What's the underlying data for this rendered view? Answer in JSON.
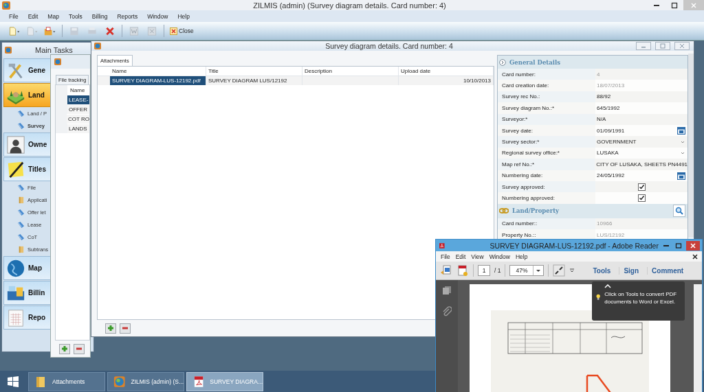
{
  "app": {
    "title": "ZILMIS (admin) (Survey diagram details. Card number: 4)"
  },
  "menu": [
    "File",
    "Edit",
    "Map",
    "Tools",
    "Billing",
    "Reports",
    "Window",
    "Help"
  ],
  "toolbar": {
    "close_label": "Close"
  },
  "main_tasks": {
    "title": "Main Tasks",
    "groups": [
      {
        "label": "Gene",
        "kind": "tools",
        "selected": false
      },
      {
        "label": "Land",
        "kind": "land",
        "selected": true,
        "items": [
          {
            "label": "Land / P",
            "kind": "document",
            "selected": false
          },
          {
            "label": "Survey",
            "kind": "document",
            "selected": true
          }
        ]
      },
      {
        "label": "Owne",
        "kind": "owner",
        "selected": false
      },
      {
        "label": "Titles",
        "kind": "titles",
        "selected": false,
        "items": [
          {
            "label": "File",
            "kind": "document",
            "selected": false
          },
          {
            "label": "Applicati",
            "kind": "folder",
            "selected": false
          },
          {
            "label": "Offer let",
            "kind": "document",
            "selected": false
          },
          {
            "label": "Lease",
            "kind": "document",
            "selected": false
          },
          {
            "label": "CoT",
            "kind": "document",
            "selected": false
          },
          {
            "label": "Subtrans",
            "kind": "folder",
            "selected": false
          }
        ]
      },
      {
        "label": "Map",
        "kind": "globe",
        "selected": false
      },
      {
        "label": "Billin",
        "kind": "billing",
        "selected": false
      },
      {
        "label": "Repo",
        "kind": "reports",
        "selected": false
      }
    ]
  },
  "file_tracking": {
    "tab": "File tracking",
    "column": "Name",
    "rows": [
      {
        "name": "LEASE-",
        "selected": true
      },
      {
        "name": "OFFER",
        "selected": false
      },
      {
        "name": "COT RO",
        "selected": false
      },
      {
        "name": "LANDS",
        "selected": false
      }
    ]
  },
  "survey_window": {
    "title": "Survey diagram details. Card number: 4",
    "tab": "Attachments",
    "columns": [
      "Name",
      "Title",
      "Description",
      "Upload date"
    ],
    "rows": [
      {
        "name": "SURVEY DIAGRAM-LUS-12192.pdf",
        "title": "SURVEY DIAGRAM LUS/12192",
        "upload_date": "10/10/2013",
        "selected": true
      }
    ]
  },
  "general_details": {
    "title": "General Details",
    "fields": [
      {
        "label": "Card number:",
        "value": "4",
        "kind": "readonly"
      },
      {
        "label": "Card creation date:",
        "value": "18/07/2013",
        "kind": "readonly"
      },
      {
        "label": "Survey rec No.:",
        "value": "88/92",
        "kind": "text"
      },
      {
        "label": "Survey diagram No.:*",
        "value": "645/1992",
        "kind": "text"
      },
      {
        "label": "Surveyor:*",
        "value": "N/A",
        "kind": "text"
      },
      {
        "label": "Survey date:",
        "value": "01/09/1991",
        "kind": "date"
      },
      {
        "label": "Survey sector:*",
        "value": "GOVERNMENT",
        "kind": "select"
      },
      {
        "label": "Regional survey office:*",
        "value": "LUSAKA",
        "kind": "select"
      },
      {
        "label": "Map ref No.:*",
        "value": "CITY OF LUSAKA, SHEETS PN4491",
        "kind": "text"
      },
      {
        "label": "Numbering date:",
        "value": "24/05/1992",
        "kind": "date"
      },
      {
        "label": "Survey approved:",
        "checked": true,
        "kind": "checkbox"
      },
      {
        "label": "Numbering approved:",
        "checked": true,
        "kind": "checkbox"
      }
    ]
  },
  "land_property": {
    "title": "Land/Property",
    "fields": [
      {
        "label": "Card number::",
        "value": "10966",
        "kind": "readonly"
      },
      {
        "label": "Property No.::",
        "value": "LUS/12192",
        "kind": "readonly"
      }
    ]
  },
  "adobe": {
    "title": "SURVEY DIAGRAM-LUS-12192.pdf - Adobe Reader",
    "menu": [
      "File",
      "Edit",
      "View",
      "Window",
      "Help"
    ],
    "page": "1",
    "page_total": "/ 1",
    "zoom": "47%",
    "actions": [
      "Tools",
      "Sign",
      "Comment"
    ],
    "tooltip": "Click on Tools to convert PDF documents to Word or Excel."
  },
  "taskbar": [
    {
      "label": "Attachments",
      "kind": "folder",
      "selected": false
    },
    {
      "label": "ZILMIS (admin) (S...",
      "kind": "app",
      "selected": false
    },
    {
      "label": "SURVEY DIAGRA...",
      "kind": "pdf",
      "selected": true
    }
  ]
}
